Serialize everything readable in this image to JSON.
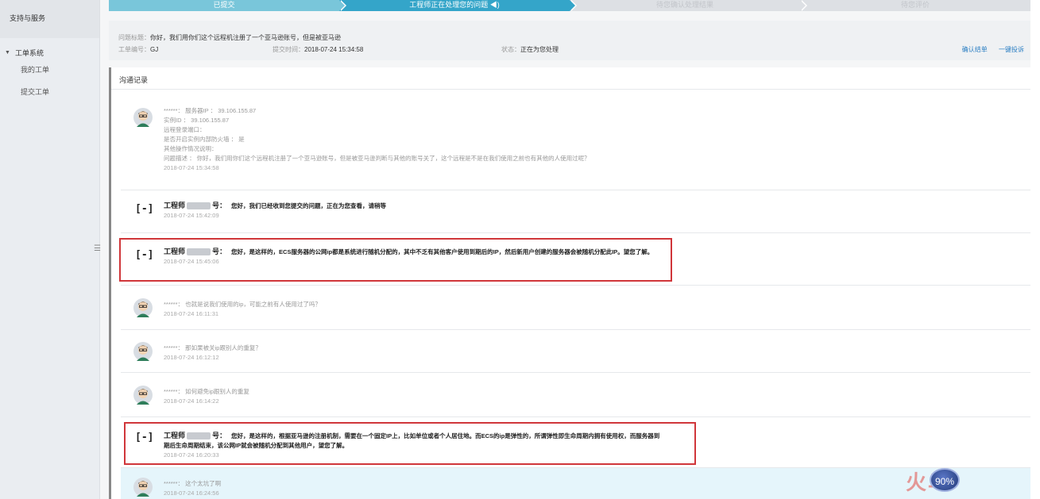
{
  "sidebar": {
    "title": "支持与服务",
    "group": "工单系统",
    "items": [
      {
        "label": "我的工单"
      },
      {
        "label": "提交工单"
      }
    ]
  },
  "steps": [
    {
      "label": "已提交",
      "state": "done"
    },
    {
      "label": "工程师正在处理您的问题 ◀)",
      "state": "active"
    },
    {
      "label": "待您确认处理结果",
      "state": "todo"
    },
    {
      "label": "待您评价",
      "state": "todo"
    }
  ],
  "ticket": {
    "title_label": "问题标题：",
    "title_value": "你好，我们用你们这个远程机注册了一个亚马逊账号，但是被亚马逊",
    "number_label": "工单编号：",
    "number_value": "GJ",
    "time_label": "提交时间：",
    "time_value": "2018-07-24 15:34:58",
    "status_label": "状态：",
    "status_value": "正在为您处理",
    "action_confirm": "确认结单",
    "action_complain": "一键投诉"
  },
  "panel": {
    "title": "沟通记录"
  },
  "messages": [
    {
      "type": "user",
      "lines": [
        "******： 服务器IP ： 39.106.155.87",
        "实例ID ： 39.106.155.87",
        "远程登录端口：",
        "是否开启实例内部防火墙 ： 是",
        "其他操作情况说明：",
        "问题描述 ： 你好，我们用你们这个远程机注册了一个亚马逊账号，但是被亚马逊判断与其他的账号关了，这个远程是不是在我们使用之前也有其他的人使用过呢？"
      ],
      "time": "2018-07-24 15:34:58"
    },
    {
      "type": "engineer",
      "who": "工程师",
      "who_suffix": "号：",
      "text": "您好，我们已经收到您提交的问题，正在为您查看，请稍等",
      "time": "2018-07-24 15:42:09"
    },
    {
      "type": "engineer",
      "who": "工程师",
      "who_suffix": "号：",
      "text": "您好，是这样的，ECS服务器的公网ip都是系统进行随机分配的，其中不乏有其他客户使用到期后的IP，然后新用户创建的服务器会被随机分配此IP。望您了解。",
      "time": "2018-07-24 15:45:06"
    },
    {
      "type": "user",
      "lines": [
        "******： 也就是说我们使用的ip，可能之前有人使用过了吗？"
      ],
      "time": "2018-07-24 16:11:31"
    },
    {
      "type": "user",
      "lines": [
        "******： 那如果被关ip跟别人的重复？"
      ],
      "time": "2018-07-24 16:12:12"
    },
    {
      "type": "user",
      "lines": [
        "******： 如何避免ip跟别人的重复"
      ],
      "time": "2018-07-24 16:14:22"
    },
    {
      "type": "engineer",
      "who": "工程师",
      "who_suffix": "号：",
      "text": "您好，是这样的，根据亚马逊的注册机制，需要在一个固定IP上，比如单位或者个人居住地。而ECS的ip是弹性的，所谓弹性即生命周期内拥有使用权，而服务器到期后生命周期结束，该公网IP就会被随机分配到其他用户，望您了解。",
      "time": "2018-07-24 16:20:33"
    },
    {
      "type": "user",
      "lines": [
        "******： 这个太坑了啊"
      ],
      "time": "2018-07-24 16:24:56"
    }
  ],
  "speed_badge": "90%",
  "watermark": "火鸟"
}
